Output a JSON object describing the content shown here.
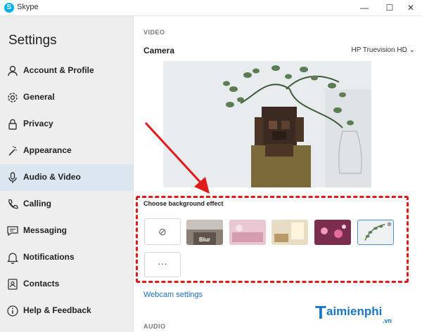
{
  "window": {
    "title": "Skype",
    "min_symbol": "—",
    "max_symbol": "☐",
    "close_symbol": "✕"
  },
  "sidebar": {
    "heading": "Settings",
    "items": [
      {
        "label": "Account & Profile",
        "icon": "person-icon"
      },
      {
        "label": "General",
        "icon": "gear-icon"
      },
      {
        "label": "Privacy",
        "icon": "lock-icon"
      },
      {
        "label": "Appearance",
        "icon": "wand-icon"
      },
      {
        "label": "Audio & Video",
        "icon": "microphone-icon",
        "active": true
      },
      {
        "label": "Calling",
        "icon": "phone-icon"
      },
      {
        "label": "Messaging",
        "icon": "chat-icon"
      },
      {
        "label": "Notifications",
        "icon": "bell-icon"
      },
      {
        "label": "Contacts",
        "icon": "contacts-icon"
      },
      {
        "label": "Help & Feedback",
        "icon": "info-icon"
      }
    ]
  },
  "video": {
    "section_label": "VIDEO",
    "camera_label": "Camera",
    "camera_device": "HP Truevision HD ⌄"
  },
  "background_effect": {
    "title": "Choose background effect",
    "none_symbol": "⊘",
    "blur_label": "Blur",
    "more_symbol": "···"
  },
  "webcam_settings": "Webcam settings",
  "audio": {
    "section_label": "AUDIO"
  },
  "watermark": {
    "name": "aimienphi",
    "sub": ".vn",
    "mark": "T"
  },
  "colors": {
    "accent": "#1d6ec2",
    "highlight": "#e11a1a",
    "active_nav": "#dbe6f0"
  }
}
